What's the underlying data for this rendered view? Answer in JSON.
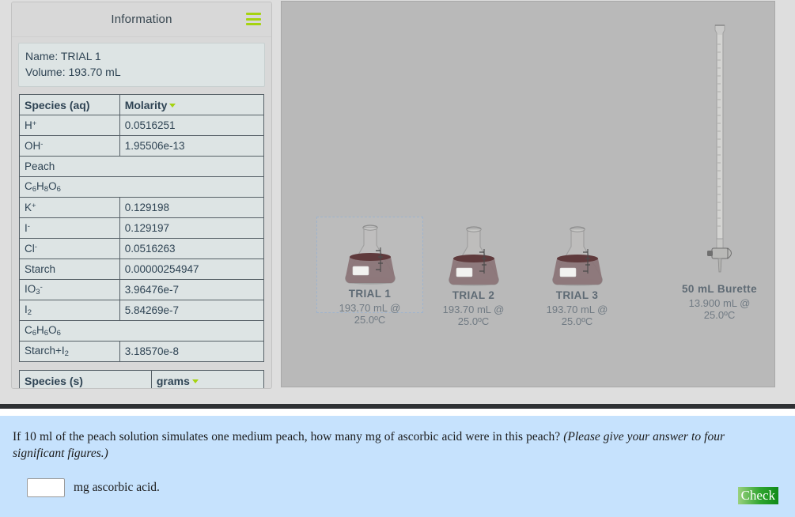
{
  "info_panel": {
    "title": "Information",
    "menu_icon": "hamburger-icon",
    "name_line": "Name: TRIAL 1",
    "volume_line": "Volume: 193.70 mL",
    "aqueous_table": {
      "headers": [
        "Species (aq)",
        "Molarity"
      ],
      "sort_indicator": "caret-down-icon",
      "rows": [
        {
          "species_html": "H<sup>+</sup>",
          "species_text": "H+",
          "value": "0.0516251"
        },
        {
          "species_html": "OH<sup>-</sup>",
          "species_text": "OH-",
          "value": "1.95506e-13"
        },
        {
          "species_html": "Peach",
          "species_text": "Peach",
          "value": ""
        },
        {
          "species_html": "C<sub>6</sub>H<sub>8</sub>O<sub>6</sub>",
          "species_text": "C6H8O6",
          "value": ""
        },
        {
          "species_html": "K<sup>+</sup>",
          "species_text": "K+",
          "value": "0.129198"
        },
        {
          "species_html": "I<sup>-</sup>",
          "species_text": "I-",
          "value": "0.129197"
        },
        {
          "species_html": "Cl<sup>-</sup>",
          "species_text": "Cl-",
          "value": "0.0516263"
        },
        {
          "species_html": "Starch",
          "species_text": "Starch",
          "value": "0.00000254947"
        },
        {
          "species_html": "IO<sub>3</sub><sup>-</sup>",
          "species_text": "IO3-",
          "value": "3.96476e-7"
        },
        {
          "species_html": "I<sub>2</sub>",
          "species_text": "I2",
          "value": "5.84269e-7"
        },
        {
          "species_html": "C<sub>6</sub>H<sub>6</sub>O<sub>6</sub>",
          "species_text": "C6H6O6",
          "value": ""
        },
        {
          "species_html": "Starch+I<sub>2</sub>",
          "species_text": "Starch+I2",
          "value": "3.18570e-8"
        }
      ]
    },
    "solid_table": {
      "headers": [
        "Species (s)",
        "grams"
      ],
      "sort_indicator": "caret-down-icon"
    }
  },
  "bench": {
    "stations": [
      {
        "name": "TRIAL 1",
        "detail": "193.70 mL @ 25.0ºC",
        "type": "flask",
        "selected": true
      },
      {
        "name": "TRIAL 2",
        "detail": "193.70 mL @ 25.0ºC",
        "type": "flask",
        "selected": false
      },
      {
        "name": "TRIAL 3",
        "detail": "193.70 mL @ 25.0ºC",
        "type": "flask",
        "selected": false
      },
      {
        "name": "50 mL Burette",
        "detail": "13.900 mL @ 25.0ºC",
        "type": "burette",
        "selected": false
      }
    ]
  },
  "question": {
    "prompt_main": "If 10 ml of the peach solution simulates one medium peach, how many mg of ascorbic acid were in this peach?",
    "prompt_italic": "(Please give your answer to four significant figures.)",
    "answer_value": "",
    "answer_placeholder": "",
    "answer_units": "mg ascorbic acid.",
    "check_label": "Check"
  },
  "colors": {
    "accent_green": "#a5d310",
    "check_green": "#2fa52f",
    "panel_bg": "#d8d8d8",
    "bench_bg": "#b9b9b9",
    "question_bg": "#c6e2fd",
    "text_dark": "#2f4454"
  }
}
